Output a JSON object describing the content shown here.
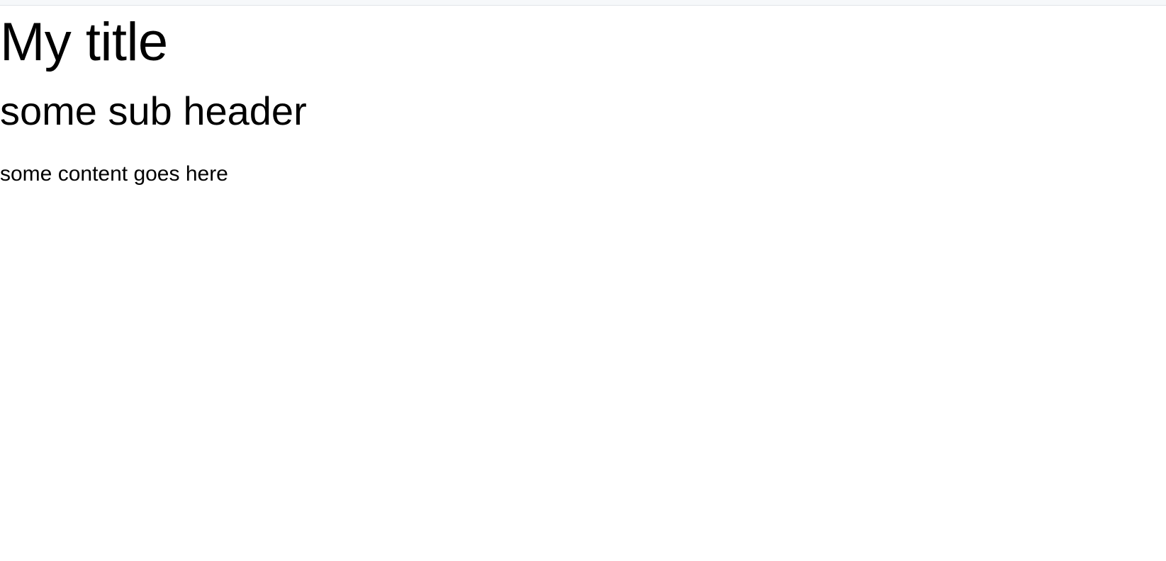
{
  "page": {
    "title": "My title",
    "subheader": "some sub header",
    "content": "some content goes here"
  }
}
